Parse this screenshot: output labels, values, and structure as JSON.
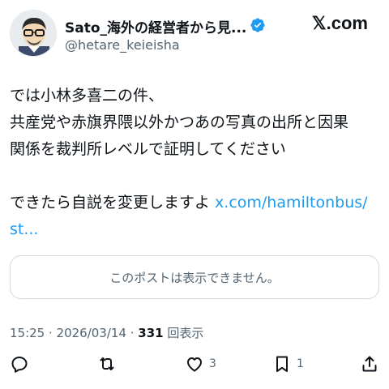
{
  "user": {
    "display_name": "Sato_海外の経営者から見...",
    "handle": "@hetare_keieisha"
  },
  "brand": {
    "label": "𝕏.com"
  },
  "tweet": {
    "lines": [
      "では小林多喜二の件、",
      "共産党や赤旗界隈以外かつあの写真の出所と因果",
      "関係を裁判所レベルで証明してください"
    ],
    "line4_text": "できたら自説を変更しますよ ",
    "link_part1": "x.com/hamiltonbus/",
    "link_part2": "st..."
  },
  "quote": {
    "unavailable_text": "このポストは表示できません。"
  },
  "meta": {
    "time_date": "15:25 · 2026/03/14 · ",
    "views_count": "331",
    "views_label": " 回表示"
  },
  "actions": {
    "reply_count": "",
    "retweet_count": "",
    "like_count": "3",
    "bookmark_count": "1"
  },
  "colors": {
    "link": "#1d9bf0",
    "secondary_text": "#536471",
    "verified": "#1d9bf0",
    "border": "#cfd9de"
  }
}
